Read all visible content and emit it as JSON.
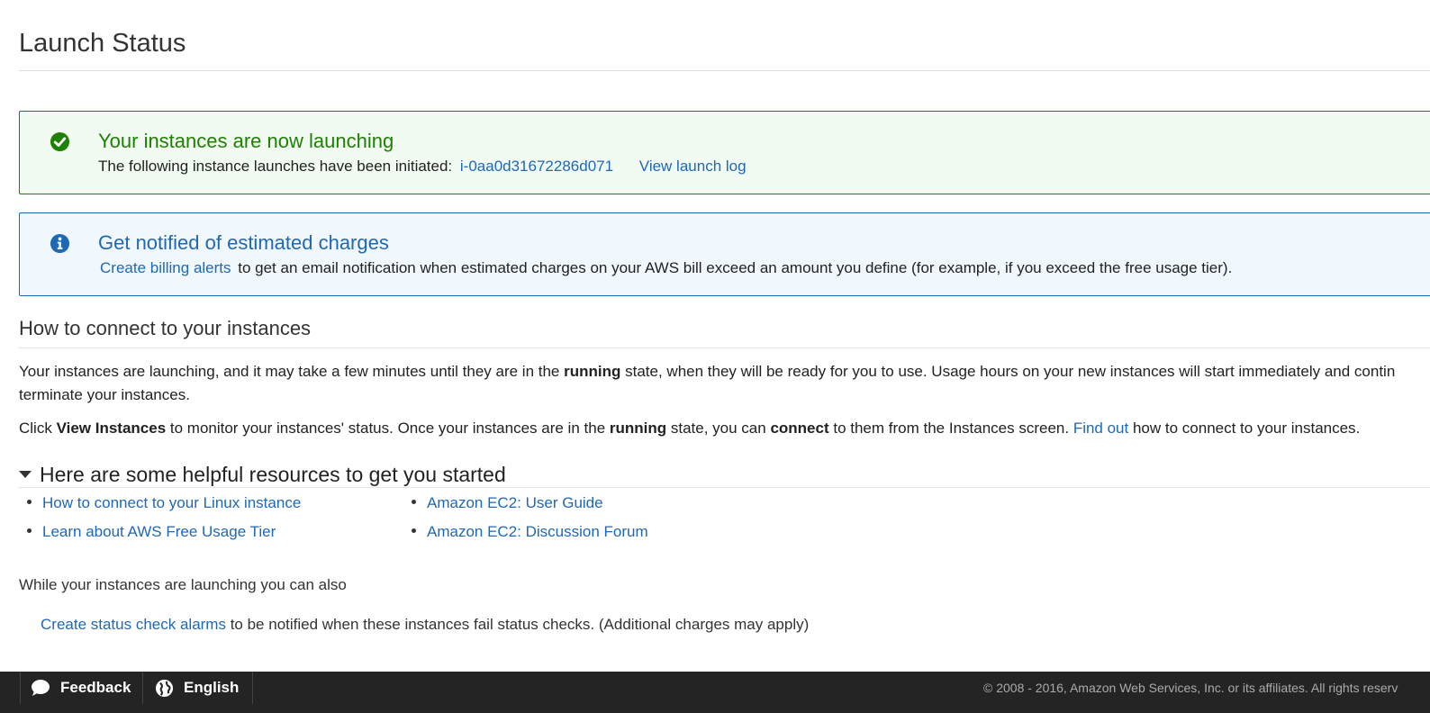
{
  "page": {
    "title": "Launch Status"
  },
  "success_alert": {
    "icon": "check-circle-icon",
    "color": "#1d8102",
    "title": "Your instances are now launching",
    "body_text": "The following instance launches have been initiated:",
    "instance_id": "i-0aa0d31672286d071",
    "view_log_label": "View launch log"
  },
  "info_alert": {
    "icon": "info-circle-icon",
    "color": "#1f68b3",
    "title": "Get notified of estimated charges",
    "link_label": "Create billing alerts",
    "body_text": "to get an email notification when estimated charges on your AWS bill exceed an amount you define (for example, if you exceed the free usage tier)."
  },
  "connect_section": {
    "heading": "How to connect to your instances",
    "para1": {
      "part1": "Your instances are launching, and it may take a few minutes until they are in the ",
      "bold1": "running",
      "part2": " state, when they will be ready for you to use. Usage hours on your new instances will start immediately and contin",
      "line2": "terminate your instances."
    },
    "para2": {
      "part1": "Click ",
      "bold1": "View Instances",
      "part2": " to monitor your instances' status. Once your instances are in the ",
      "bold2": "running",
      "part3": " state, you can ",
      "bold3": "connect",
      "part4": " to them from the Instances screen. ",
      "link": "Find out",
      "part5": " how to connect to your instances."
    }
  },
  "resources": {
    "heading": "Here are some helpful resources to get you started",
    "expanded": true,
    "left": [
      "How to connect to your Linux instance",
      "Learn about AWS Free Usage Tier"
    ],
    "right": [
      "Amazon EC2: User Guide",
      "Amazon EC2: Discussion Forum"
    ]
  },
  "while_launching": {
    "text": "While your instances are launching you can also",
    "alarm_link": "Create status check alarms",
    "alarm_text": "to be notified when these instances fail status checks. (Additional charges may apply)"
  },
  "footer": {
    "feedback_label": "Feedback",
    "feedback_icon": "speech-bubble-icon",
    "language_label": "English",
    "language_icon": "globe-icon",
    "copyright": "© 2008 - 2016, Amazon Web Services, Inc. or its affiliates. All rights reserv"
  }
}
